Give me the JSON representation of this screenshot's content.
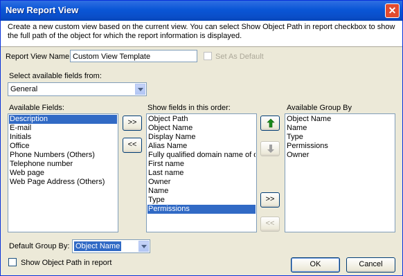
{
  "window": {
    "title": "New Report View",
    "close_glyph": "✕",
    "description": "Create a new custom view based on the current view. You can select Show Object Path in report checkbox to show the full path of the object for which the report information is displayed."
  },
  "report_view_name": {
    "label": "Report View Name:",
    "value": "Custom View Template"
  },
  "set_as_default": {
    "label": "Set As Default",
    "checked": false
  },
  "fields_source": {
    "label": "Select available fields from:",
    "selected": "General"
  },
  "available_fields": {
    "label": "Available Fields:",
    "items": [
      "Description",
      "E-mail",
      "Initials",
      "Office",
      "Phone Numbers (Others)",
      "Telephone number",
      "Web page",
      "Web Page Address (Others)"
    ],
    "selected_index": 0
  },
  "show_fields": {
    "label": "Show fields in this order:",
    "items": [
      "Object Path",
      "Object Name",
      "Display Name",
      "Alias Name",
      "Fully qualified domain name of ol",
      "First name",
      "Last name",
      "Owner",
      "Name",
      "Type",
      "Permissions"
    ],
    "selected_index": 10
  },
  "available_group_by": {
    "label": "Available Group By",
    "items": [
      "Object Name",
      "Name",
      "Type",
      "Permissions",
      "Owner"
    ]
  },
  "buttons": {
    "add": ">>",
    "remove": "<<",
    "move_up_icon": "up-arrow-icon",
    "move_down_icon": "down-arrow-icon",
    "add_group": ">>",
    "remove_group": "<<",
    "ok": "OK",
    "cancel": "Cancel"
  },
  "default_group_by": {
    "label": "Default Group By:",
    "selected": "Object Name"
  },
  "show_object_path": {
    "label": "Show Object Path in report",
    "checked": false
  },
  "colors": {
    "title_bar": "#0a56d6",
    "selection": "#316ac5",
    "dialog_bg": "#ece9d8",
    "up_arrow": "#1a8a1a",
    "down_arrow_disabled": "#a0a0a0"
  }
}
